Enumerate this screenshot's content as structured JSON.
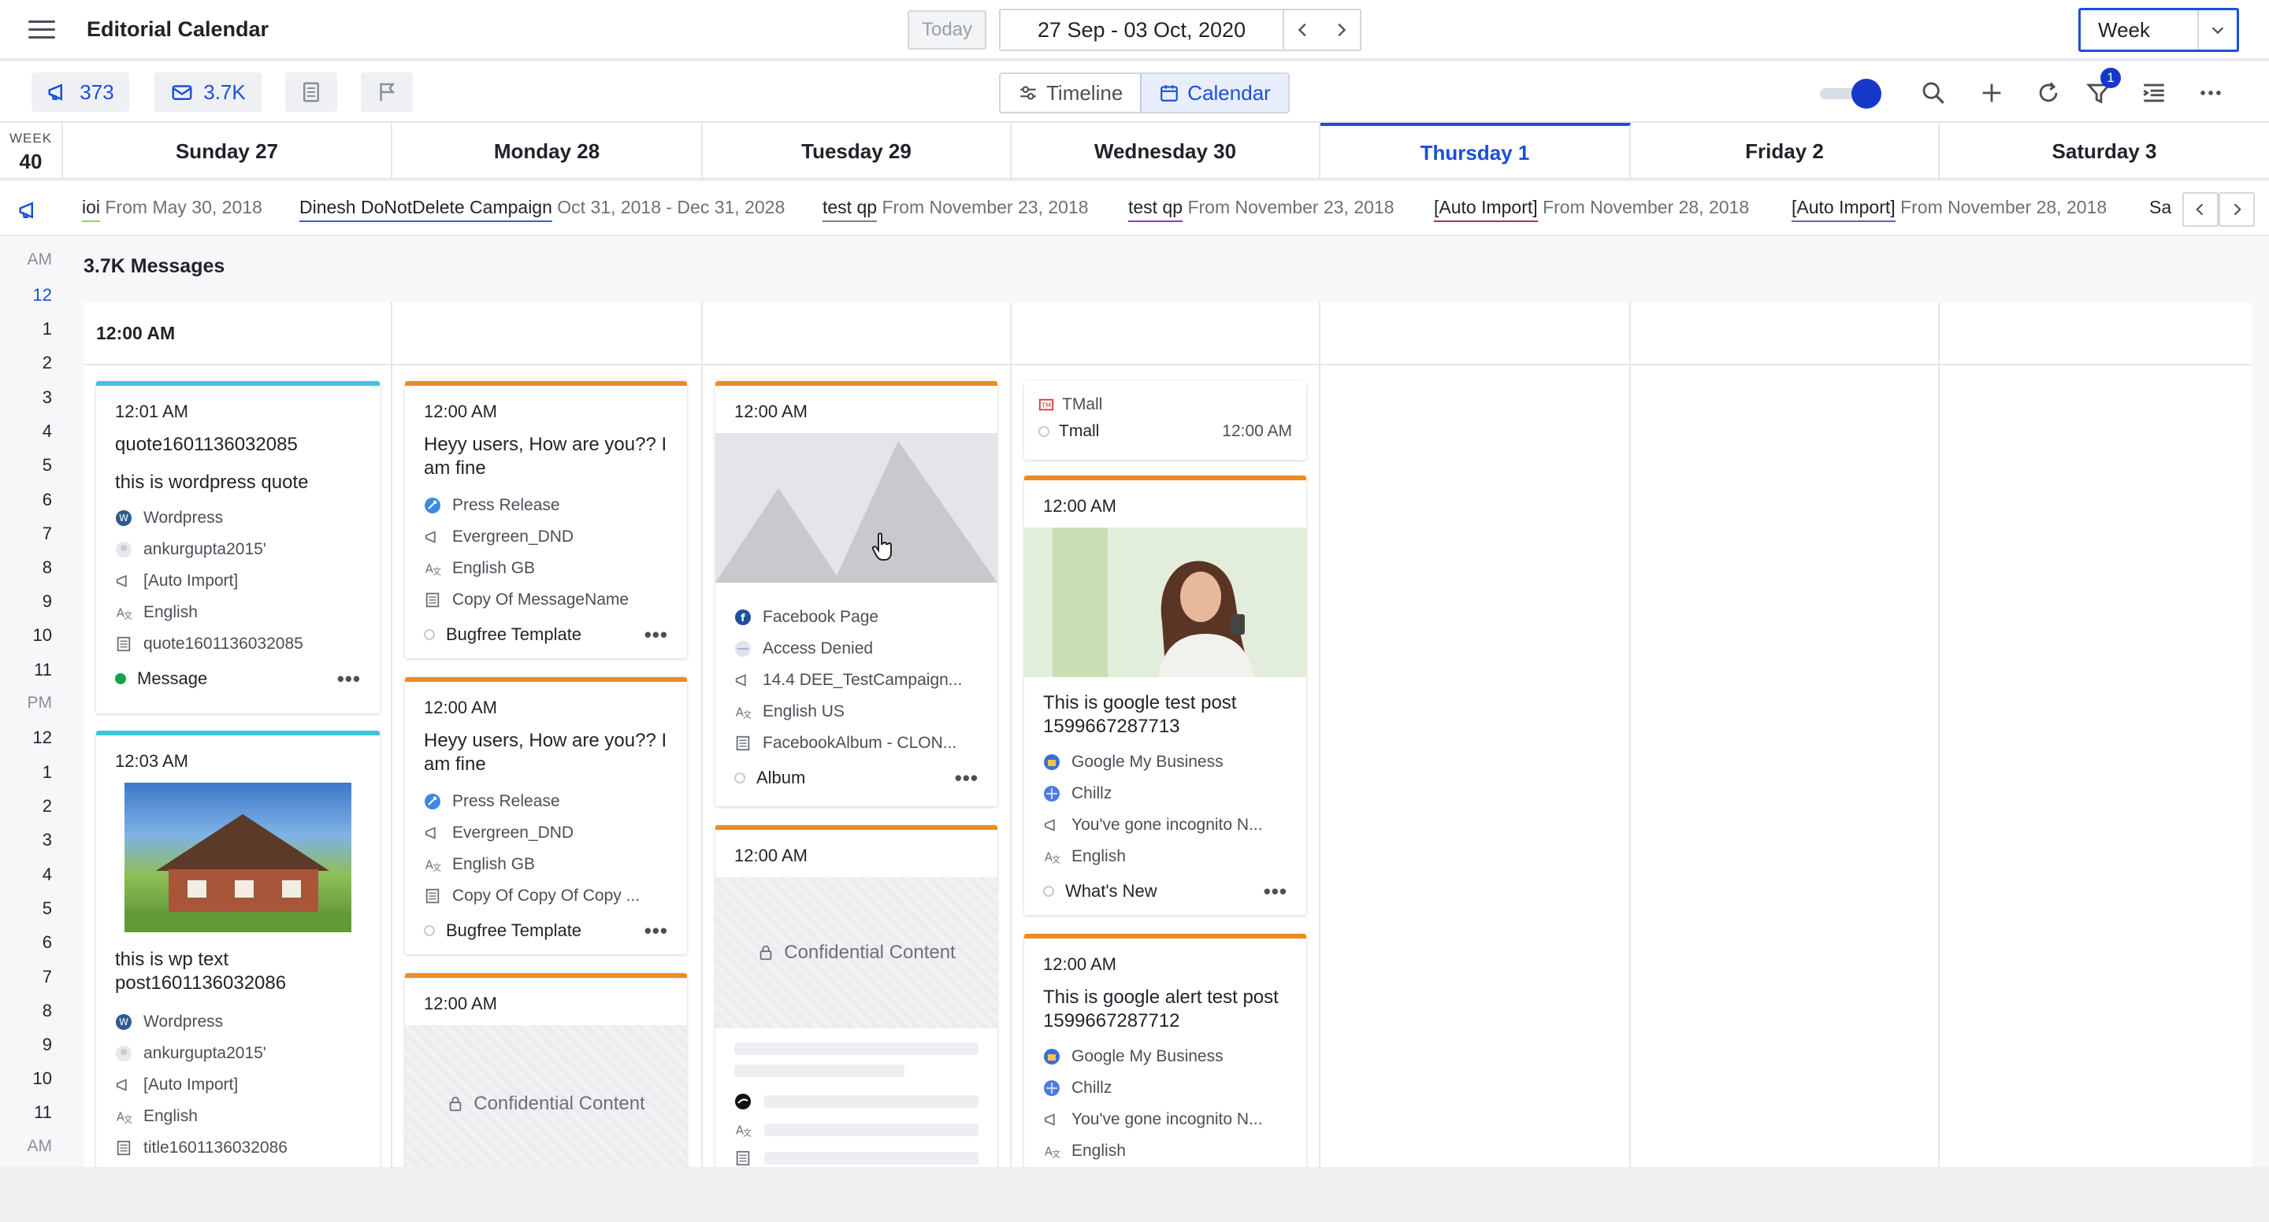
{
  "header": {
    "title": "Editorial Calendar",
    "today_label": "Today",
    "date_range": "27 Sep - 03 Oct, 2020",
    "view": "Week"
  },
  "toolbar": {
    "campaign_count": "373",
    "message_count": "3.7K",
    "timeline_label": "Timeline",
    "calendar_label": "Calendar",
    "filter_badge": "1"
  },
  "week": {
    "label": "WEEK",
    "number": "40"
  },
  "days": [
    {
      "label": "Sunday 27"
    },
    {
      "label": "Monday 28"
    },
    {
      "label": "Tuesday 29"
    },
    {
      "label": "Wednesday 30"
    },
    {
      "label": "Thursday 1"
    },
    {
      "label": "Friday 2"
    },
    {
      "label": "Saturday 3"
    }
  ],
  "campaigns": [
    {
      "name": "ioi",
      "range": "From May 30, 2018",
      "color": "#9bd04b"
    },
    {
      "name": "Dinesh DoNotDelete Campaign",
      "range": "Oct 31, 2018 - Dec 31, 2028",
      "color": "#3b5bdb"
    },
    {
      "name": "test qp",
      "range": "From November 23, 2018",
      "color": "#7a7f88"
    },
    {
      "name": "test qp",
      "range": "From November 23, 2018",
      "color": "#7c3aed"
    },
    {
      "name": "[Auto Import]",
      "range": "From November 28, 2018",
      "color": "#c0265e"
    },
    {
      "name": "[Auto Import]",
      "range": "From November 28, 2018",
      "color": "#6d5bd0"
    },
    {
      "name": "Sa",
      "range": "",
      "color": "#3b5bdb"
    }
  ],
  "hours": [
    "AM",
    "12",
    "1",
    "2",
    "3",
    "4",
    "5",
    "6",
    "7",
    "8",
    "9",
    "10",
    "11",
    "PM",
    "12",
    "1",
    "2",
    "3",
    "4",
    "5",
    "6",
    "7",
    "8",
    "9",
    "10",
    "11",
    "AM"
  ],
  "messages_count_label": "3.7K Messages",
  "slot_time": "12:00 AM",
  "cards": {
    "sun1": {
      "time": "12:01 AM",
      "title": "quote1601136032085",
      "body": "this is wordpress quote",
      "rows": [
        "Wordpress",
        "ankurgupta2015'",
        "[Auto Import]",
        "English",
        "quote1601136032085"
      ],
      "status": "Message"
    },
    "sun2": {
      "time": "12:03 AM",
      "title": "this is wp text post1601136032086",
      "rows": [
        "Wordpress",
        "ankurgupta2015'",
        "[Auto Import]",
        "English",
        "title1601136032086"
      ]
    },
    "mon1": {
      "time": "12:00 AM",
      "title": "Heyy users, How are you?? I am fine",
      "rows": [
        "Press Release",
        "Evergreen_DND",
        "English GB",
        "Copy Of MessageName"
      ],
      "status": "Bugfree Template"
    },
    "mon2": {
      "time": "12:00 AM",
      "title": "Heyy users, How are you?? I am fine",
      "rows": [
        "Press Release",
        "Evergreen_DND",
        "English GB",
        "Copy Of Copy Of Copy ..."
      ],
      "status": "Bugfree Template"
    },
    "mon3": {
      "time": "12:00 AM",
      "confidential": "Confidential Content"
    },
    "tue1": {
      "time": "12:00 AM",
      "rows": [
        "Facebook Page",
        "Access Denied",
        "14.4 DEE_TestCampaign...",
        "English US",
        "FacebookAlbum - CLON..."
      ],
      "status": "Album"
    },
    "tue2": {
      "time": "12:00 AM",
      "confidential": "Confidential Content"
    },
    "wed0": {
      "source": "TMall",
      "account": "Tmall",
      "time": "12:00 AM"
    },
    "wed1": {
      "time": "12:00 AM",
      "title": "This is google test post 1599667287713",
      "rows": [
        "Google My Business",
        "Chillz",
        "You've gone incognito N...",
        "English"
      ],
      "status": "What's New"
    },
    "wed2": {
      "time": "12:00 AM",
      "title": "This is google alert test post 1599667287712",
      "rows": [
        "Google My Business",
        "Chillz",
        "You've gone incognito N...",
        "English"
      ]
    }
  },
  "colors": {
    "accent": "#1b4fd8",
    "orange_bar": "#f08c1e",
    "teal_bar": "#3bc6d9"
  },
  "icons": [
    "hamburger-icon",
    "chevron-left-icon",
    "chevron-right-icon",
    "chevron-down-icon",
    "megaphone-icon",
    "envelope-icon",
    "document-icon",
    "flag-icon",
    "timeline-icon",
    "calendar-icon",
    "search-icon",
    "plus-icon",
    "refresh-icon",
    "filter-icon",
    "list-settings-icon",
    "more-icon",
    "lock-icon",
    "wordpress-icon",
    "user-icon",
    "language-icon",
    "press-release-icon",
    "facebook-icon",
    "google-my-business-icon"
  ]
}
